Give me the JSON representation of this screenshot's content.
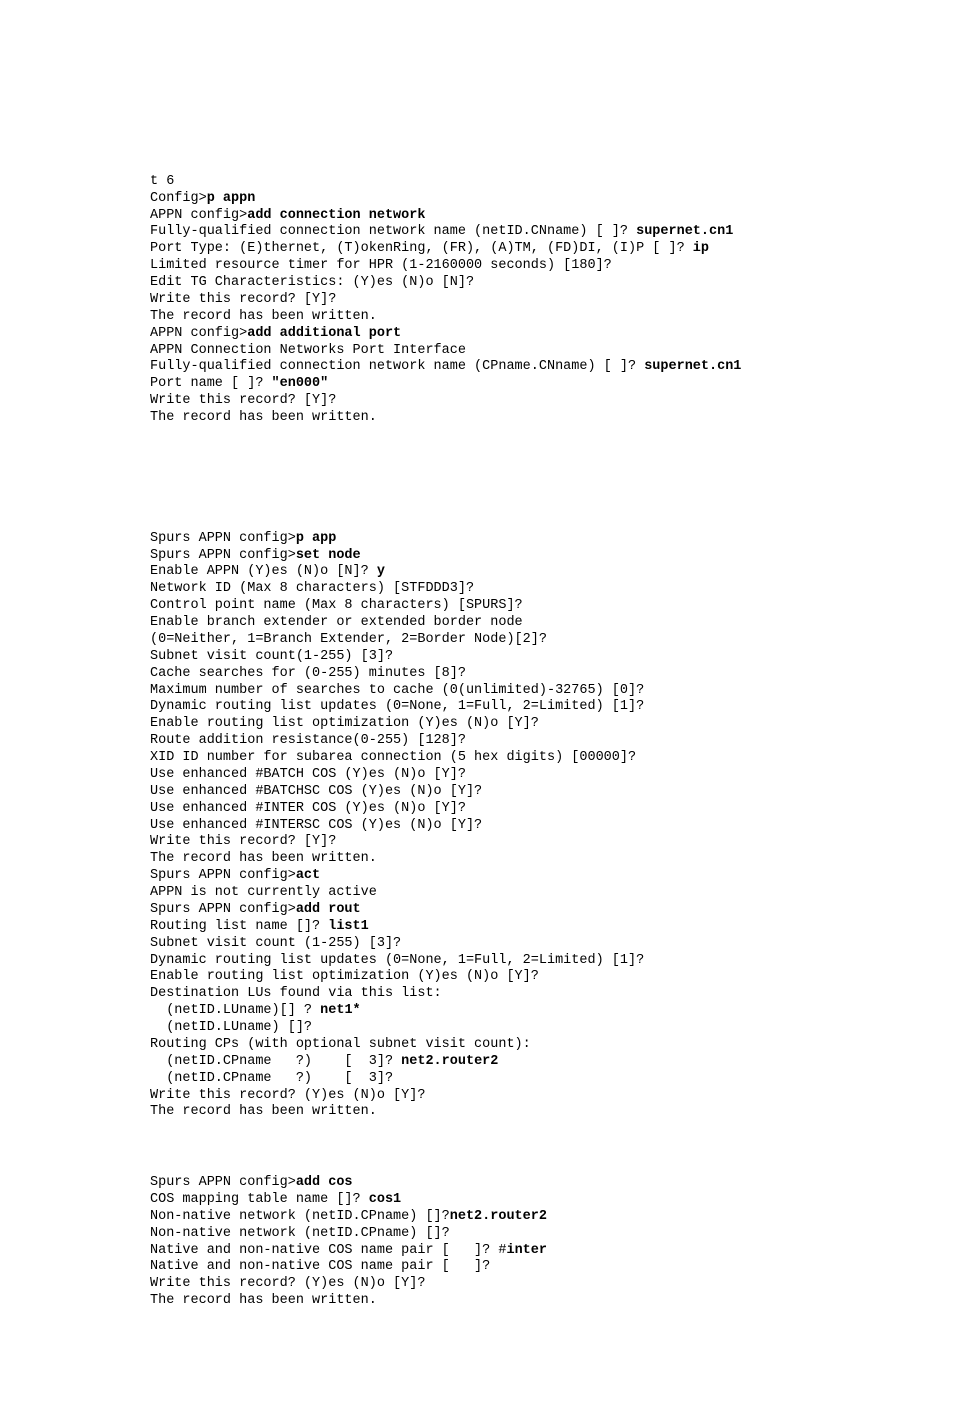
{
  "block1": {
    "l0": "t 6",
    "l1a": "Config>",
    "l1b": "p appn",
    "l2a": "APPN config>",
    "l2b": "add connection network",
    "l3a": "Fully-qualified connection network name (netID.CNname) [ ]? ",
    "l3b": "supernet.cn1",
    "l4a": "Port Type: (E)thernet, (T)okenRing, (FR), (A)TM, (FD)DI, (I)P [ ]? ",
    "l4b": "ip",
    "l5": "Limited resource timer for HPR (1-2160000 seconds) [180]?",
    "l6": "Edit TG Characteristics: (Y)es (N)o [N]?",
    "l7": "Write this record? [Y]?",
    "l8": "The record has been written.",
    "l9a": "APPN config>",
    "l9b": "add additional port",
    "l10": "APPN Connection Networks Port Interface",
    "l11a": "Fully-qualified connection network name (CPname.CNname) [ ]? ",
    "l11b": "supernet.cn1",
    "l12a": "Port name [ ]? ",
    "l12b": "\"en000\"",
    "l13": "Write this record? [Y]?",
    "l14": "The record has been written."
  },
  "block2": {
    "l0a": "Spurs APPN config>",
    "l0b": "p app",
    "l1a": "Spurs APPN config>",
    "l1b": "set node",
    "l2a": "Enable APPN (Y)es (N)o [N]? ",
    "l2b": "y",
    "l3": "Network ID (Max 8 characters) [STFDDD3]?",
    "l4": "Control point name (Max 8 characters) [SPURS]?",
    "l5": "Enable branch extender or extended border node",
    "l6": "(0=Neither, 1=Branch Extender, 2=Border Node)[2]?",
    "l7": "Subnet visit count(1-255) [3]?",
    "l8": "Cache searches for (0-255) minutes [8]?",
    "l9": "Maximum number of searches to cache (0(unlimited)-32765) [0]?",
    "l10": "Dynamic routing list updates (0=None, 1=Full, 2=Limited) [1]?",
    "l11": "Enable routing list optimization (Y)es (N)o [Y]?",
    "l12": "Route addition resistance(0-255) [128]?",
    "l13": "XID ID number for subarea connection (5 hex digits) [00000]?",
    "l14": "Use enhanced #BATCH COS (Y)es (N)o [Y]?",
    "l15": "Use enhanced #BATCHSC COS (Y)es (N)o [Y]?",
    "l16": "Use enhanced #INTER COS (Y)es (N)o [Y]?",
    "l17": "Use enhanced #INTERSC COS (Y)es (N)o [Y]?",
    "l18": "Write this record? [Y]?",
    "l19": "The record has been written.",
    "l20a": "Spurs APPN config>",
    "l20b": "act",
    "l21": "APPN is not currently active",
    "l22a": "Spurs APPN config>",
    "l22b": "add rout",
    "l23a": "Routing list name []? ",
    "l23b": "list1",
    "l24": "Subnet visit count (1-255) [3]?",
    "l25": "Dynamic routing list updates (0=None, 1=Full, 2=Limited) [1]?",
    "l26": "Enable routing list optimization (Y)es (N)o [Y]?",
    "l27": "Destination LUs found via this list:",
    "l28a": "  (netID.LUname)[] ? ",
    "l28b": "net1*",
    "l29": "  (netID.LUname) []?",
    "l30": "Routing CPs (with optional subnet visit count):",
    "l31a": "  (netID.CPname   ?)    [  3]? ",
    "l31b": "net2.router2",
    "l32": "  (netID.CPname   ?)    [  3]?",
    "l33": "Write this record? (Y)es (N)o [Y]?",
    "l34": "The record has been written."
  },
  "block3": {
    "l0a": "Spurs APPN config>",
    "l0b": "add cos",
    "l1a": "COS mapping table name []? ",
    "l1b": "cos1",
    "l2a": "Non-native network (netID.CPname) []?",
    "l2b": "net2.router2",
    "l3": "Non-native network (netID.CPname) []?",
    "l4a": "Native and non-native COS name pair [   ]? #",
    "l4b": "inter",
    "l5": "Native and non-native COS name pair [   ]?",
    "l6": "Write this record? (Y)es (N)o [Y]?",
    "l7": "The record has been written."
  }
}
